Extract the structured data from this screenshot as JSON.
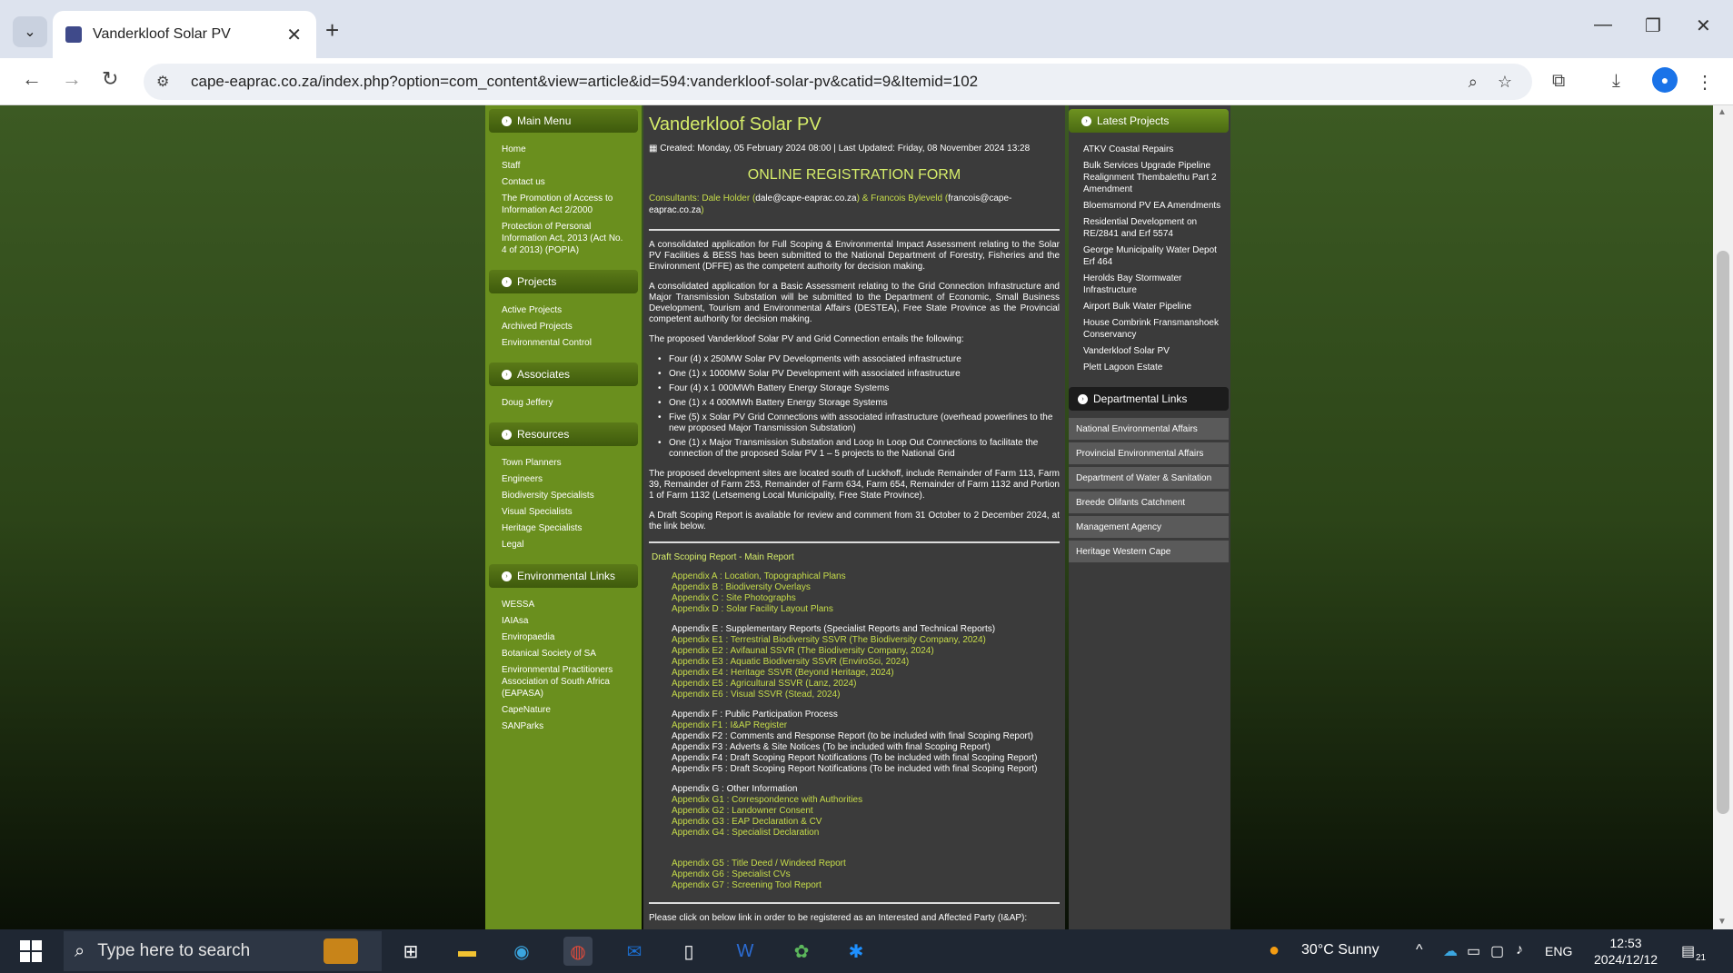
{
  "browser": {
    "tab_title": "Vanderkloof Solar PV",
    "url": "cape-eaprac.co.za/index.php?option=com_content&view=article&id=594:vanderkloof-solar-pv&catid=9&Itemid=102"
  },
  "left": {
    "sections": [
      {
        "title": "Main Menu",
        "items": [
          "Home",
          "Staff",
          "Contact us",
          "The Promotion of Access to Information Act 2/2000",
          "Protection of Personal Information Act, 2013 (Act No. 4 of 2013) (POPIA)"
        ]
      },
      {
        "title": "Projects",
        "items": [
          "Active Projects",
          "Archived Projects",
          "Environmental Control"
        ]
      },
      {
        "title": "Associates",
        "items": [
          "Doug Jeffery"
        ]
      },
      {
        "title": "Resources",
        "items": [
          "Town Planners",
          "Engineers",
          "Biodiversity Specialists",
          "Visual Specialists",
          "Heritage Specialists",
          "Legal"
        ]
      },
      {
        "title": "Environmental Links",
        "items": [
          "WESSA",
          "IAIAsa",
          "Enviropaedia",
          "Botanical Society of SA",
          "Environmental Practitioners Association of South Africa (EAPASA)",
          "CapeNature",
          "SANParks"
        ]
      }
    ]
  },
  "article": {
    "title": "Vanderkloof Solar PV",
    "meta": "Created: Monday, 05 February 2024 08:00 | Last Updated: Friday, 08 November 2024 13:28",
    "reg_heading": "ONLINE REGISTRATION FORM",
    "consult_prefix": "Consultants: Dale Holder (",
    "consult_email1": "dale@cape-eaprac.co.za",
    "consult_mid": ") & Francois Byleveld (",
    "consult_email2": "francois@cape-eaprac.co.za",
    "consult_suffix": ")",
    "para1": "A consolidated application for Full Scoping & Environmental Impact Assessment relating to the Solar PV Facilities & BESS has been submitted to the National Department of Forestry, Fisheries and the Environment (DFFE) as the competent authority for decision making.",
    "para2": "A consolidated application for a Basic Assessment relating to the Grid Connection Infrastructure and Major Transmission Substation will be submitted to the Department of Economic, Small Business Development, Tourism and Environmental Affairs (DESTEA), Free State Province as the Provincial competent authority for decision making.",
    "para3": "The proposed Vanderkloof Solar PV and Grid Connection entails the following:",
    "bullets": [
      "Four (4) x 250MW Solar PV Developments with associated infrastructure",
      "One (1) x 1000MW Solar PV Development with associated infrastructure",
      "Four (4) x 1 000MWh Battery Energy Storage Systems",
      "One (1) x 4 000MWh Battery Energy Storage Systems",
      "Five (5) x Solar PV Grid Connections with associated infrastructure (overhead powerlines to the new proposed Major Transmission Substation)",
      "One (1) x Major Transmission Substation and Loop In Loop Out Connections to facilitate the connection of the proposed Solar PV 1 – 5 projects to the National Grid"
    ],
    "para4": "The proposed development sites are located south of Luckhoff, include Remainder of Farm 113, Farm 39, Remainder of Farm 253, Remainder of Farm 634, Farm 654, Remainder of Farm 1132 and Portion 1 of Farm 1132 (Letsemeng Local Municipality, Free State Province).",
    "para5": "A Draft Scoping Report is available for review and comment from 31 October to 2 December 2024, at the link below.",
    "main_report": "Draft Scoping Report - Main Report",
    "appendix_groups": [
      [
        {
          "text": "Appendix A   : Location, Topographical Plans",
          "link": true
        },
        {
          "text": "Appendix B   : Biodiversity Overlays",
          "link": true
        },
        {
          "text": "Appendix C   : Site Photographs",
          "link": true
        },
        {
          "text": "Appendix D   : Solar Facility Layout Plans",
          "link": true
        }
      ],
      [
        {
          "text": "Appendix E   : Supplementary Reports (Specialist Reports and Technical Reports)",
          "link": false
        },
        {
          "text": "Appendix E1 : Terrestrial Biodiversity SSVR (The Biodiversity Company, 2024)",
          "link": true
        },
        {
          "text": "Appendix E2 : Avifaunal SSVR (The Biodiversity Company, 2024)",
          "link": true
        },
        {
          "text": "Appendix E3 : Aquatic Biodiversity SSVR (EnviroSci, 2024)",
          "link": true
        },
        {
          "text": "Appendix E4 : Heritage SSVR (Beyond Heritage, 2024)",
          "link": true
        },
        {
          "text": "Appendix E5 : Agricultural SSVR (Lanz, 2024)",
          "link": true
        },
        {
          "text": "Appendix E6 : Visual SSVR (Stead, 2024)",
          "link": true
        }
      ],
      [
        {
          "text": "Appendix F   : Public Participation Process",
          "link": false
        },
        {
          "text": "Appendix F1 : I&AP Register",
          "link": true
        },
        {
          "text": "Appendix F2 : Comments and Response Report (to be included with final Scoping Report)",
          "link": false
        },
        {
          "text": "Appendix F3 : Adverts & Site Notices (To be included with final Scoping Report)",
          "link": false
        },
        {
          "text": "Appendix F4 : Draft Scoping Report Notifications (To be included with final Scoping Report)",
          "link": false
        },
        {
          "text": "Appendix F5 : Draft Scoping Report Notifications (To be included with final Scoping Report)",
          "link": false
        }
      ],
      [
        {
          "text": "Appendix G   : Other Information",
          "link": false
        },
        {
          "text": "Appendix G1 : Correspondence with Authorities",
          "link": true
        },
        {
          "text": "Appendix G2 : Landowner Consent",
          "link": true
        },
        {
          "text": "Appendix G3 : EAP Declaration & CV",
          "link": true
        },
        {
          "text": "Appendix G4 : Specialist Declaration",
          "link": true
        }
      ],
      [
        {
          "text": "Appendix G5 : Title Deed / Windeed Report",
          "link": true
        },
        {
          "text": "Appendix G6 : Specialist CVs",
          "link": true
        },
        {
          "text": "Appendix G7 : Screening Tool Report",
          "link": true
        }
      ]
    ],
    "final": "Please click on below link in order to be registered as an Interested and Affected Party (I&AP):"
  },
  "right": {
    "latest_title": "Latest Projects",
    "latest": [
      "ATKV Coastal Repairs",
      "Bulk Services Upgrade Pipeline Realignment Thembalethu Part 2 Amendment",
      "Bloemsmond PV EA Amendments",
      "Residential Development on RE/2841 and Erf 5574",
      "George Municipality Water Depot Erf 464",
      "Herolds Bay Stormwater Infrastructure",
      "Airport Bulk Water Pipeline",
      "House Combrink Fransmanshoek Conservancy",
      "Vanderkloof Solar PV",
      "Plett Lagoon Estate"
    ],
    "dept_title": "Departmental Links",
    "dept": [
      "National Environmental Affairs",
      "Provincial Environmental Affairs",
      "Department of Water & Sanitation",
      "Breede Olifants Catchment",
      "Management Agency",
      "Heritage Western Cape"
    ]
  },
  "taskbar": {
    "search_placeholder": "Type here to search",
    "weather": "30°C  Sunny",
    "lang": "ENG",
    "time": "12:53",
    "date": "2024/12/12",
    "notif_count": "21"
  }
}
